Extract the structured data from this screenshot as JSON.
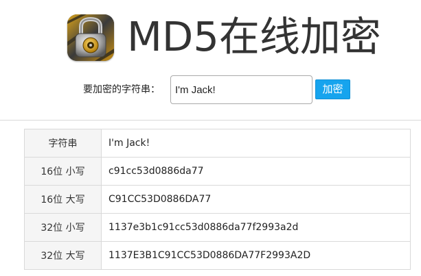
{
  "header": {
    "title": "MD5在线加密",
    "logo_icon": "padlock-icon"
  },
  "form": {
    "label": "要加密的字符串：",
    "input_value": "I'm Jack!",
    "button_label": "加密",
    "button_color": "#16a4ee"
  },
  "results": {
    "rows": [
      {
        "key": "字符串",
        "value": "I'm Jack!"
      },
      {
        "key": "16位 小写",
        "value": "c91cc53d0886da77"
      },
      {
        "key": "16位 大写",
        "value": "C91CC53D0886DA77"
      },
      {
        "key": "32位 小写",
        "value": "1137e3b1c91cc53d0886da77f2993a2d"
      },
      {
        "key": "32位 大写",
        "value": "1137E3B1C91CC53D0886DA77F2993A2D"
      }
    ]
  }
}
